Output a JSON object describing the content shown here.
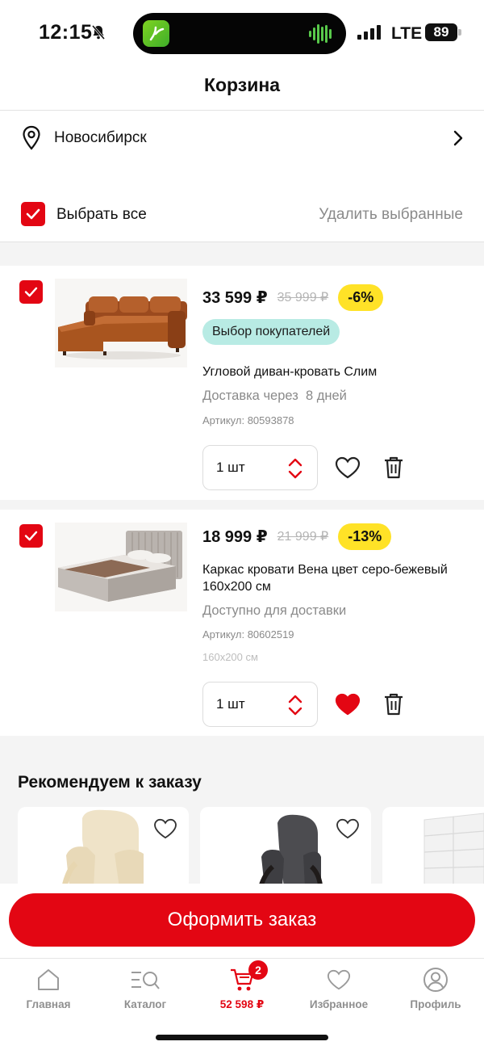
{
  "status_bar": {
    "time": "12:15",
    "network": "LTE",
    "battery": "89"
  },
  "header": {
    "title": "Корзина"
  },
  "location": {
    "city": "Новосибирск"
  },
  "selection": {
    "select_all_label": "Выбрать все",
    "delete_selected_label": "Удалить выбранные"
  },
  "cart_items": [
    {
      "price": "33 599 ₽",
      "old_price": "35 999 ₽",
      "discount": "-6%",
      "badge": "Выбор покупателей",
      "name": "Угловой диван-кровать Слим",
      "delivery": "Доставка через  8 дней",
      "article": "Артикул: 80593878",
      "quantity": "1 шт",
      "favorite": false
    },
    {
      "price": "18 999 ₽",
      "old_price": "21 999 ₽",
      "discount": "-13%",
      "name": "Каркас кровати Вена цвет серо-бежевый 160х200 см",
      "delivery": "Доступно для доставки",
      "article": "Артикул: 80602519",
      "size": "160х200 см",
      "quantity": "1 шт",
      "favorite": true
    }
  ],
  "recommendations": {
    "title": "Рекомендуем к заказу"
  },
  "checkout": {
    "label": "Оформить заказ"
  },
  "tabbar": {
    "home": "Главная",
    "catalog": "Каталог",
    "cart": "52 598 ₽",
    "cart_count": "2",
    "favorites": "Избранное",
    "profile": "Профиль"
  },
  "colors": {
    "accent": "#e30613",
    "discount_bg": "#ffe227",
    "badge_bg": "#b8ebe4"
  }
}
